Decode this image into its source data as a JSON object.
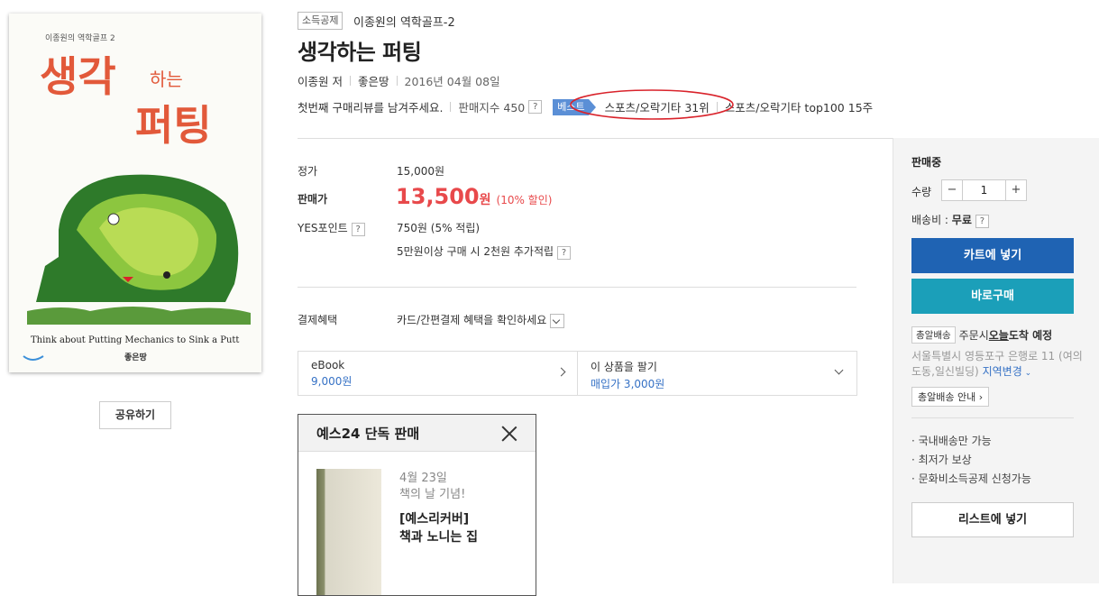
{
  "cover": {
    "series_small": "이종원의 역학골프 2",
    "title_big_1": "생각",
    "title_small": "하는",
    "title_big_2": "퍼팅",
    "subtitle": "Think about Putting Mechanics to Sink a Putt",
    "publisher_logo": "좋은땅"
  },
  "share_label": "공유하기",
  "header": {
    "tag": "소득공제",
    "series": "이종원의 역학골프-2",
    "title": "생각하는 퍼팅",
    "author": "이종원 저",
    "publisher": "좋은땅",
    "date": "2016년 04월 08일",
    "review_prompt": "첫번째 구매리뷰를 남겨주세요.",
    "sales_index": "판매지수 450",
    "help_glyph": "?",
    "best_badge": "베스트",
    "best_rank": "스포츠/오락기타 31위",
    "best_top": "스포츠/오락기타 top100 15주"
  },
  "price": {
    "list_label": "정가",
    "list_value": "15,000원",
    "sale_label": "판매가",
    "sale_value": "13,500",
    "sale_unit": "원",
    "sale_discount": "(10% 할인)",
    "point_label": "YES포인트",
    "point_value": "750원 (5% 적립)",
    "point_extra": "5만원이상 구매 시 2천원 추가적립",
    "benefit_label": "결제혜택",
    "benefit_value": "카드/간편결제 혜택을 확인하세요"
  },
  "ebook": {
    "label": "eBook",
    "price": "9,000원",
    "sell_label": "이 상품을 팔기",
    "sell_price": "매입가 3,000원"
  },
  "exclusive": {
    "title": "예스24 단독 판매",
    "date": "4월 23일",
    "event": "책의 날 기념!",
    "product_line1": "[예스리커버]",
    "product_line2": "책과 노니는 집"
  },
  "panel": {
    "status": "판매중",
    "qty_label": "수량",
    "qty_value": "1",
    "minus": "−",
    "plus": "+",
    "shipping_label": "배송비 : ",
    "shipping_value": "무료",
    "cart_button": "카트에 넣기",
    "buy_button": "바로구매",
    "delivery_badge": "총알배송",
    "delivery_text_pre": "주문시 ",
    "delivery_today": "오늘",
    "delivery_text_post": " 도착 예정",
    "address": "서울특별시 영등포구 은행로 11 (여의도동,일신빌딩)",
    "region_change": "지역변경",
    "guide": "총알배송 안내",
    "notes": [
      "· 국내배송만 가능",
      "· 최저가 보상",
      "· 문화비소득공제 신청가능"
    ],
    "wishlist_button": "리스트에 넣기"
  },
  "colors": {
    "sale_red": "#e8494b",
    "cart_blue": "#1f63b3",
    "buy_teal": "#1b9fb9",
    "link_blue": "#3571c5",
    "best_badge": "#5b8fd6",
    "annotation_circle": "#d9232b"
  }
}
